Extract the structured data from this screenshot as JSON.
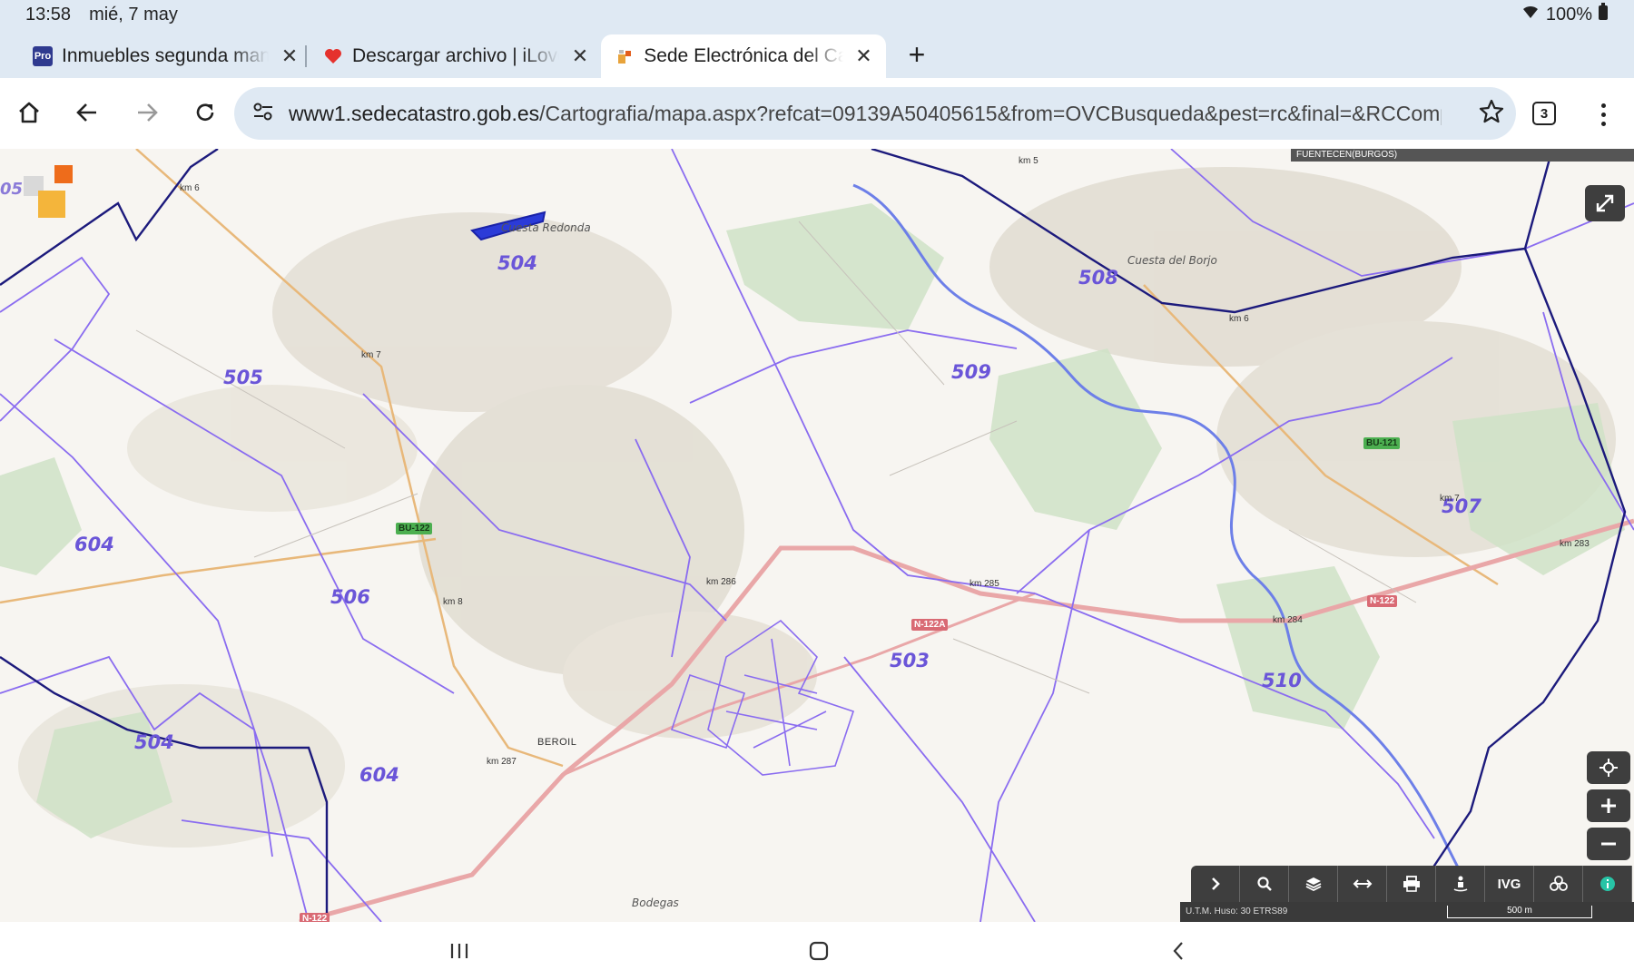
{
  "status": {
    "time": "13:58",
    "date": "mié, 7 may",
    "battery": "100%"
  },
  "tabs": [
    {
      "title": "Inmuebles segunda mano",
      "favicon": "Pro",
      "active": false
    },
    {
      "title": "Descargar archivo | iLovePDF",
      "favicon": "heart-icon",
      "active": false
    },
    {
      "title": "Sede Electrónica del Catastro",
      "favicon": "catastro-icon",
      "active": true
    }
  ],
  "toolbar": {
    "url_host": "www1.sedecatastro.gob.es",
    "url_path": "/Cartografia/mapa.aspx?refcat=09139A50405615&from=OVCBusqueda&pest=rc&final=&RCCompleta=",
    "tab_count": "3"
  },
  "map": {
    "municipality_banner": "FUENTECEN(BURGOS)",
    "polygon_labels": [
      "504",
      "505",
      "506",
      "604",
      "504",
      "604",
      "509",
      "508",
      "507",
      "503",
      "510"
    ],
    "place_names": [
      "Cuesta Redonda",
      "Cuesta del Borjo",
      "Bodegas"
    ],
    "town": "BEROIL",
    "km_labels": [
      "km 6",
      "km 7",
      "km 8",
      "km 286",
      "km 287",
      "km 285",
      "km 284",
      "km 283",
      "km 5",
      "km 6",
      "km 7"
    ],
    "roads": [
      "BU-122",
      "BU-121",
      "N-122A",
      "N-122",
      "N-122"
    ],
    "corner_label": "05",
    "coord_system": "U.T.M. Huso: 30 ETRS89",
    "scale": "500 m",
    "toolbar_text": "IVG"
  }
}
